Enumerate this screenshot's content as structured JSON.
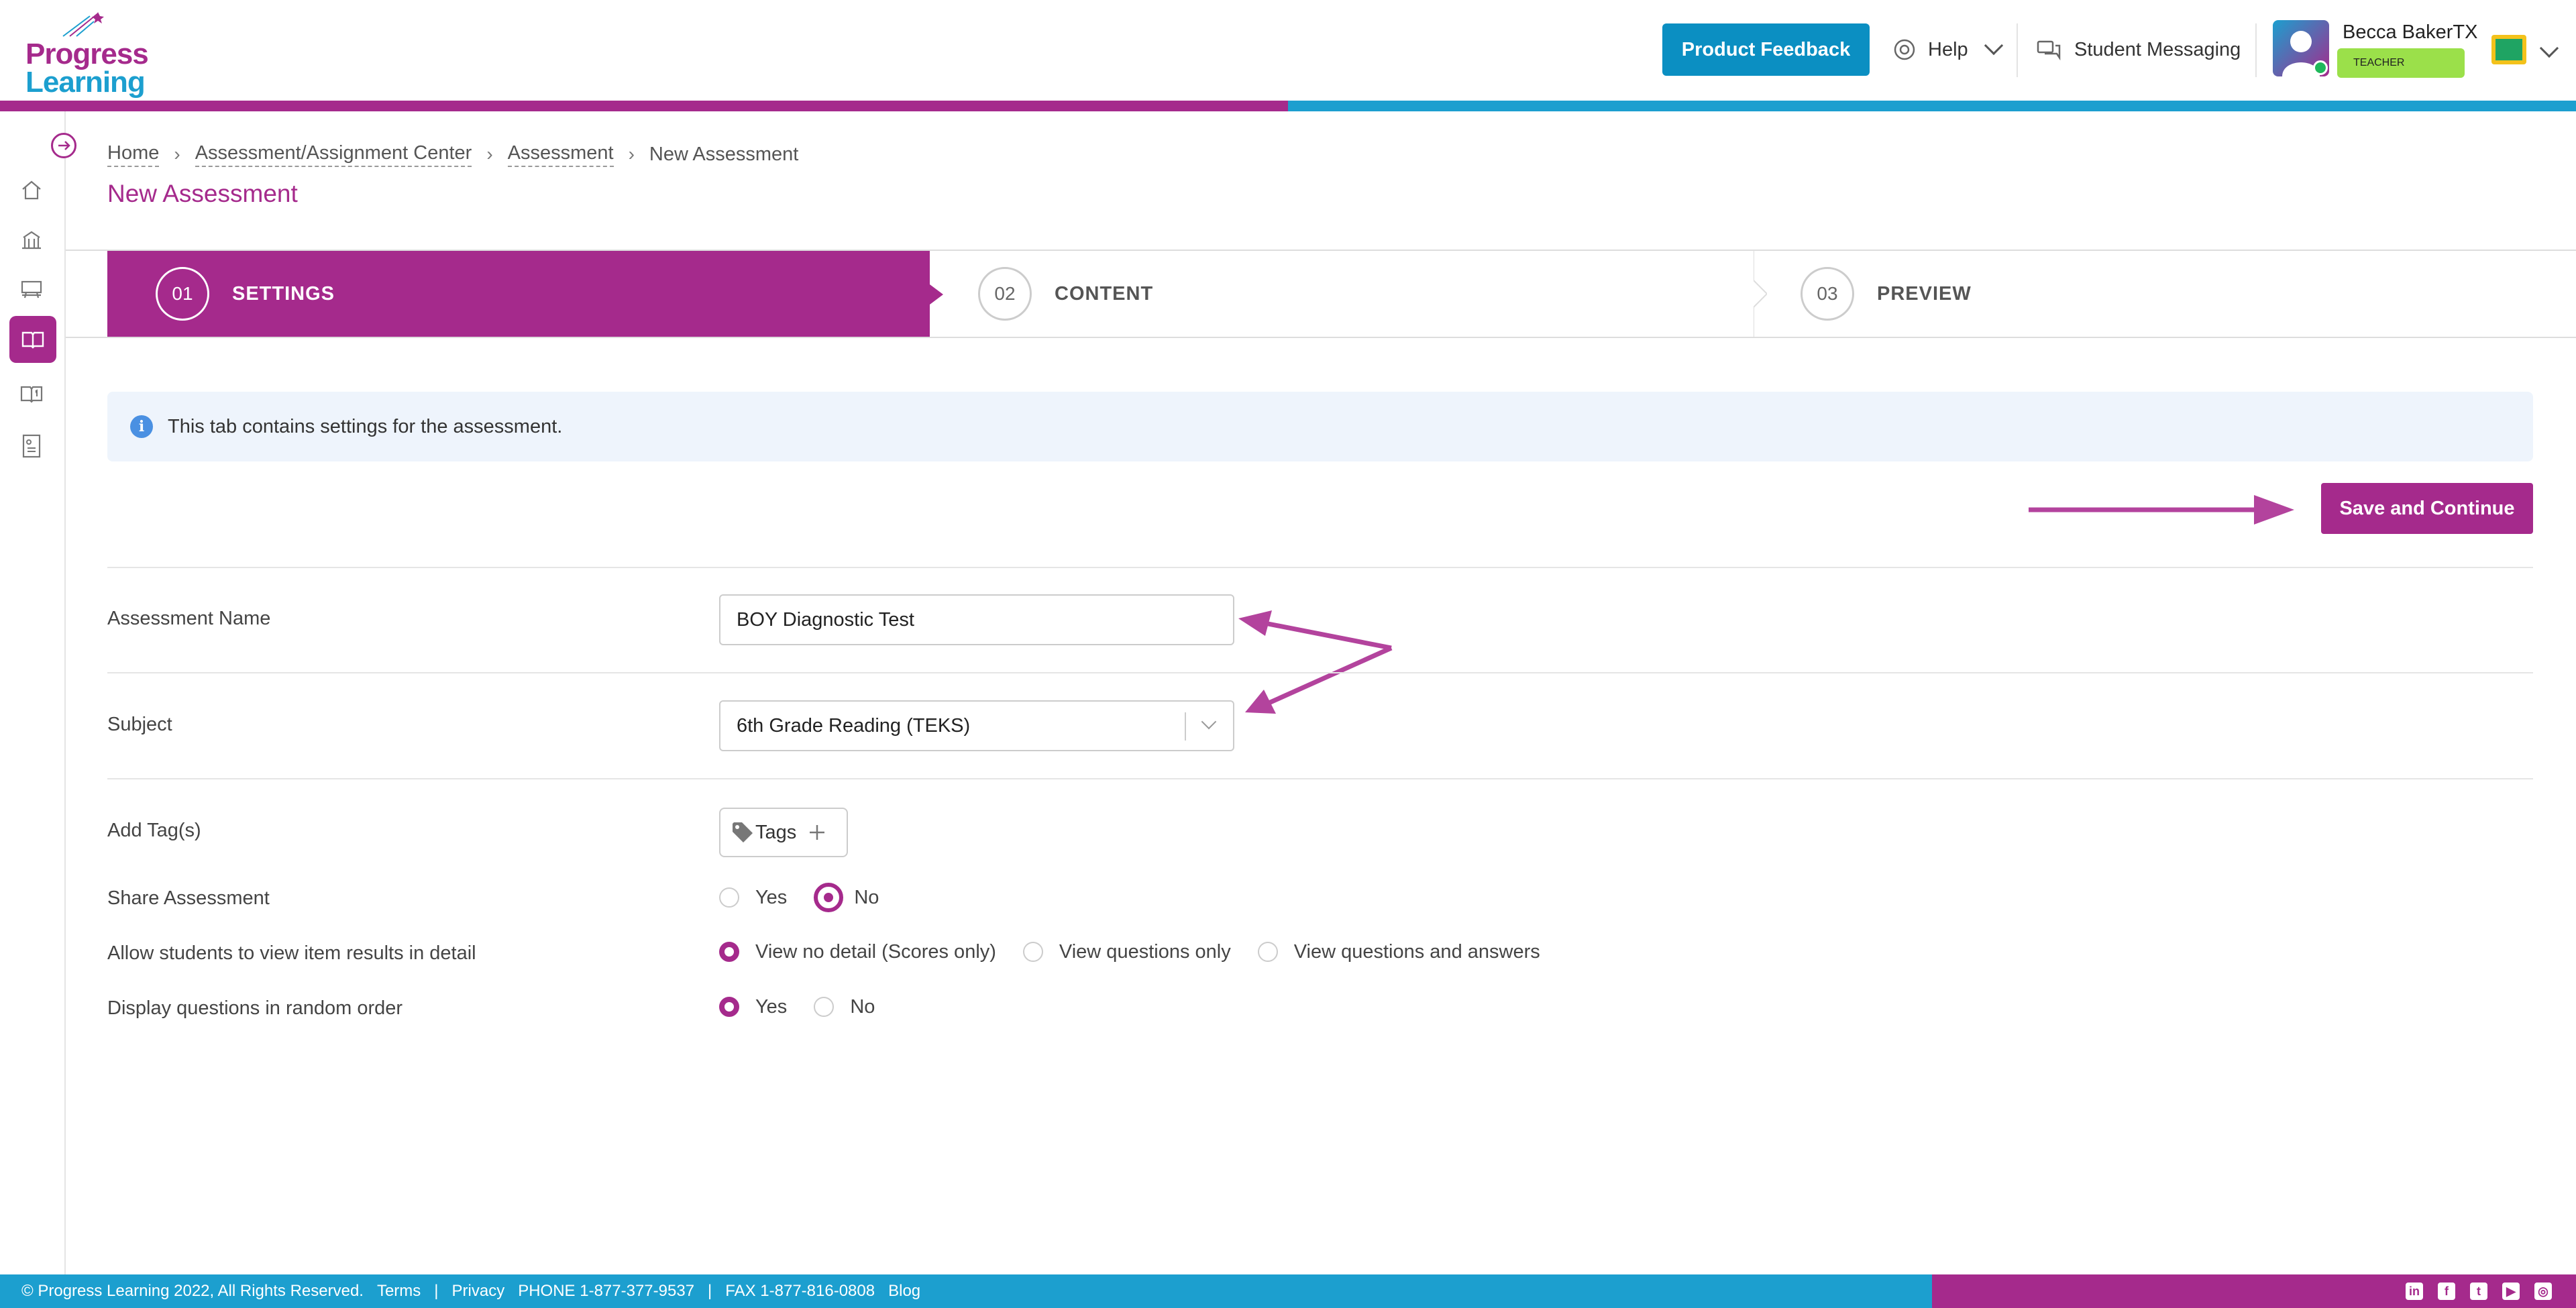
{
  "brand": {
    "logo_line1": "Progress",
    "logo_line2": "Learning",
    "purple": "#a52a8c",
    "blue": "#1c9fcf"
  },
  "header": {
    "feedback_label": "Product Feedback",
    "help_label": "Help",
    "messaging_label": "Student Messaging",
    "user_name": "Becca BakerTX",
    "user_role": "TEACHER"
  },
  "sidebar": {
    "items": [
      {
        "icon": "home-icon"
      },
      {
        "icon": "school-icon"
      },
      {
        "icon": "classroom-icon"
      },
      {
        "icon": "book-open-icon",
        "active": true
      },
      {
        "icon": "book-number-icon"
      },
      {
        "icon": "report-icon"
      }
    ]
  },
  "breadcrumb": {
    "items": [
      "Home",
      "Assessment/Assignment Center",
      "Assessment",
      "New Assessment"
    ]
  },
  "page_title": "New Assessment",
  "steps": [
    {
      "num": "01",
      "label": "SETTINGS",
      "active": true
    },
    {
      "num": "02",
      "label": "CONTENT",
      "active": false
    },
    {
      "num": "03",
      "label": "PREVIEW",
      "active": false
    }
  ],
  "info_text": "This tab contains settings for the assessment.",
  "save_label": "Save and Continue",
  "form": {
    "name_label": "Assessment Name",
    "name_value": "BOY Diagnostic Test",
    "subject_label": "Subject",
    "subject_value": "6th Grade Reading (TEKS)",
    "tags_label": "Add Tag(s)",
    "tags_button": "Tags",
    "share_label": "Share Assessment",
    "share_yes": "Yes",
    "share_no": "No",
    "share_selected": "No",
    "view_label": "Allow students to view item results in detail",
    "view_opt1": "View no detail (Scores only)",
    "view_opt2": "View questions only",
    "view_opt3": "View questions and answers",
    "view_selected": "View no detail (Scores only)",
    "random_label": "Display questions in random order",
    "random_yes": "Yes",
    "random_no": "No",
    "random_selected": "Yes"
  },
  "footer": {
    "copyright": "© Progress Learning 2022, All Rights Reserved.",
    "terms": "Terms",
    "privacy": "Privacy",
    "phone": "PHONE 1-877-377-9537",
    "fax": "FAX 1-877-816-0808",
    "blog": "Blog",
    "sep": "|",
    "social": [
      "linkedin-icon",
      "facebook-icon",
      "twitter-icon",
      "youtube-icon",
      "instagram-icon"
    ]
  }
}
